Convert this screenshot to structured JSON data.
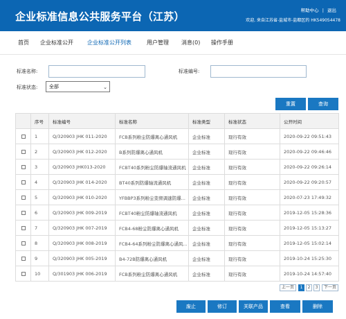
{
  "header": {
    "title": "企业标准信息公共服务平台（江苏）",
    "links": [
      "帮助中心",
      "|",
      "退出"
    ],
    "welcome": "欢迎, 来自江苏省-盐城市-盐都区的 HK549054478"
  },
  "nav": {
    "items": [
      "首页",
      "企业标准公开",
      "企业标准公开列表",
      "用户管理",
      "消息(0)",
      "操作手册"
    ],
    "active_index": 2
  },
  "search": {
    "name_label": "标准名称:",
    "name_value": "",
    "number_label": "标准编号:",
    "number_value": "",
    "status_label": "标准状态:",
    "status_value": "全部",
    "reset_label": "重置",
    "query_label": "查询"
  },
  "table": {
    "columns": [
      "",
      "序号",
      "标准编号",
      "标准名称",
      "标准类型",
      "标准状态",
      "公开时间"
    ],
    "rows": [
      [
        "1",
        "Q/320903 JHK 011-2020",
        "FCB系列粉尘防爆离心通风机",
        "企业标准",
        "现行有效",
        "2020-09-22 09:51:43"
      ],
      [
        "2",
        "Q/320903 JHK 012-2020",
        "B系列防爆离心通风机",
        "企业标准",
        "现行有效",
        "2020-09-22 09:46:46"
      ],
      [
        "3",
        "Q/320903 JHK013-2020",
        "FCBT40系列粉尘防爆轴流通风机",
        "企业标准",
        "现行有效",
        "2020-09-22 09:26:14"
      ],
      [
        "4",
        "Q/320903 JHK 014-2020",
        "BT40系列防爆轴流通风机",
        "企业标准",
        "现行有效",
        "2020-09-22 09:20:57"
      ],
      [
        "5",
        "Q/320903 JHK 010-2020",
        "YFBBP3系列粉尘变频调速防爆...",
        "企业标准",
        "现行有效",
        "2020-07-23 17:49:32"
      ],
      [
        "6",
        "Q/320903 JHK 009-2019",
        "FCBT40粉尘防爆轴流通风机",
        "企业标准",
        "现行有效",
        "2019-12-05 15:28:36"
      ],
      [
        "7",
        "Q/320903 JHK 007-2019",
        "FCB4-68粉尘防爆离心通风机",
        "企业标准",
        "现行有效",
        "2019-12-05 15:13:27"
      ],
      [
        "8",
        "Q/320903 JHK 008-2019",
        "FCB4-64系列粉尘防爆离心通风...",
        "企业标准",
        "现行有效",
        "2019-12-05 15:02:14"
      ],
      [
        "9",
        "Q/320903 JHK 005-2019",
        "B4-72B防爆离心通风机",
        "企业标准",
        "现行有效",
        "2019-10-24 15:25:30"
      ],
      [
        "10",
        "Q/301903 JHK 006-2019",
        "FCB系列粉尘防爆离心通风机",
        "企业标准",
        "现行有效",
        "2019-10-24 14:57:40"
      ]
    ]
  },
  "pager": {
    "prev": "上一页",
    "pages": [
      "1",
      "2",
      "3"
    ],
    "current": "1",
    "next": "下一页"
  },
  "actions": [
    "废止",
    "修订",
    "关联产品",
    "查看",
    "删除"
  ]
}
